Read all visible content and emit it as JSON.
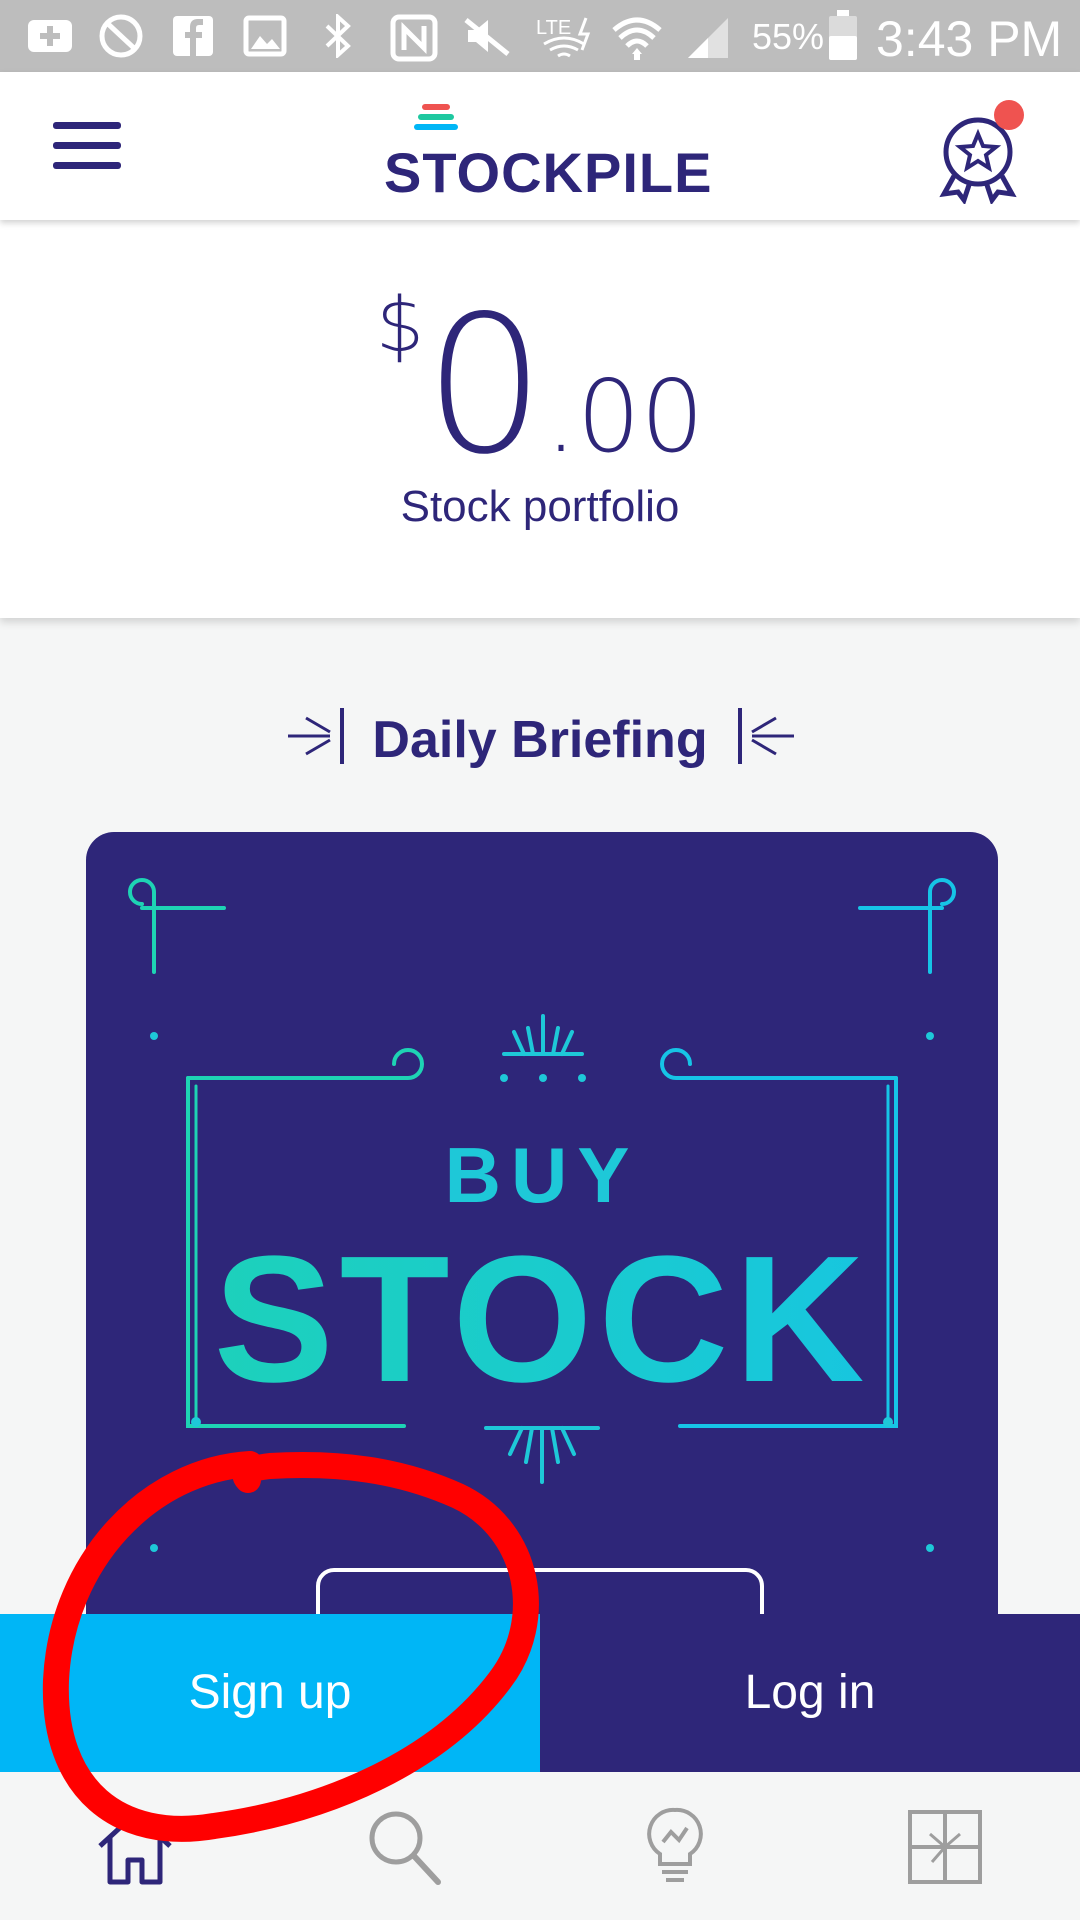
{
  "status_bar": {
    "battery_percent": "55%",
    "time": "3:43 PM",
    "icons": [
      "add-icon",
      "no-eye-icon",
      "facebook-icon",
      "image-icon",
      "bluetooth-icon",
      "nfc-icon",
      "mute-icon",
      "lte-icon",
      "wifi-icon",
      "signal-icon",
      "battery-icon"
    ]
  },
  "header": {
    "logo_text": "STOCKPILE",
    "menu_icon": "hamburger-menu-icon",
    "award_icon": "award-badge-icon"
  },
  "portfolio": {
    "currency": "$",
    "whole": "0",
    "cents": ".00",
    "label": "Stock portfolio"
  },
  "briefing": {
    "title": "Daily Briefing"
  },
  "card": {
    "line1": "BUY",
    "line2": "STOCK"
  },
  "auth": {
    "signup_label": "Sign up",
    "login_label": "Log in"
  },
  "nav": {
    "items": [
      "home-icon",
      "search-icon",
      "ideas-icon",
      "gift-icon"
    ]
  },
  "colors": {
    "brand_navy": "#2e2679",
    "signup_blue": "#00b6f6",
    "accent_teal": "#1ec8d8",
    "annotation_red": "#ff0000"
  }
}
